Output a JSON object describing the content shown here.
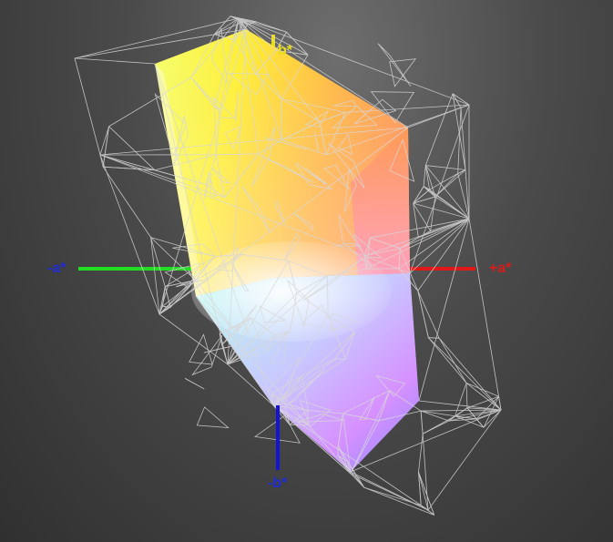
{
  "axes": {
    "neg_a": {
      "label": "-a*",
      "color": "#1f2cd4",
      "line_color": "#22dd22"
    },
    "pos_a": {
      "label": "+a*",
      "color": "#d81b1b",
      "line_color": "#e01818"
    },
    "pos_b": {
      "label": "b*",
      "color": "#e8dd1a",
      "line_color": "#e8dd1a"
    },
    "neg_b": {
      "label": "-b*",
      "color": "#1f2cd4",
      "line_color": "#1414d8"
    }
  },
  "colors": {
    "background": "#3b3b3b",
    "wireframe": "#d8d8d8",
    "yellow": "#ffff2a",
    "orange": "#ff8f4a",
    "pink": "#ff9ad0",
    "magenta": "#ee88ff",
    "blue": "#8a8aff",
    "cyan": "#a8ffe8",
    "white": "#f6f4f0"
  }
}
